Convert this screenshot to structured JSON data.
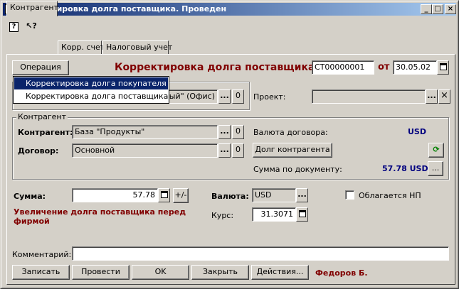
{
  "window": {
    "title": "Корректировка долга поставщика. Проведен",
    "controls": {
      "minimize": "_",
      "maximize": "□",
      "close": "×"
    }
  },
  "toolbar": {
    "help_icon": "?",
    "whats_this_icon": "↖?"
  },
  "tabs": [
    {
      "label": "Контрагент",
      "active": true
    },
    {
      "label": "Корр. счет",
      "active": false
    },
    {
      "label": "Налоговый учет",
      "active": false
    }
  ],
  "header": {
    "operation_button": "Операция",
    "doc_title": "Корректировка долга поставщика №",
    "doc_number": "СТ00000001",
    "date_label": "от",
    "date_value": "30.05.02"
  },
  "operation_menu": {
    "items": [
      {
        "label": "Корректировка долга покупателя",
        "selected": true
      },
      {
        "label": "Корректировка долга поставщика",
        "selected": false
      }
    ]
  },
  "warehouse": {
    "value": "ный\" (Офис)",
    "clear": "0"
  },
  "project": {
    "label": "Проект:",
    "value": "",
    "clear": "×"
  },
  "contractor_group": {
    "title": "Контрагент",
    "contractor_label": "Контрагент:",
    "contractor_value": "База \"Продукты\"",
    "contract_label": "Договор:",
    "contract_value": "Основной",
    "clear": "0",
    "currency_label": "Валюта договора:",
    "currency_value": "USD",
    "debt_button": "Долг контрагента",
    "doc_sum_label": "Сумма по документу:",
    "doc_sum_value": "57.78 USD"
  },
  "amount": {
    "sum_label": "Сумма:",
    "sum_value": "57.78",
    "sign_button": "+/-",
    "description": "Увеличение долга поставщика перед фирмой",
    "currency_label": "Валюта:",
    "currency_value": "USD",
    "rate_label": "Курс:",
    "rate_value": "31.3071",
    "vat_label": "Облагается НП",
    "vat_checked": false
  },
  "comment": {
    "label": "Комментарий:",
    "value": ""
  },
  "footer": {
    "save": "Записать",
    "post": "Провести",
    "ok": "OK",
    "close": "Закрыть",
    "actions": "Действия...",
    "author": "Федоров Б."
  },
  "ellipsis": "..."
}
